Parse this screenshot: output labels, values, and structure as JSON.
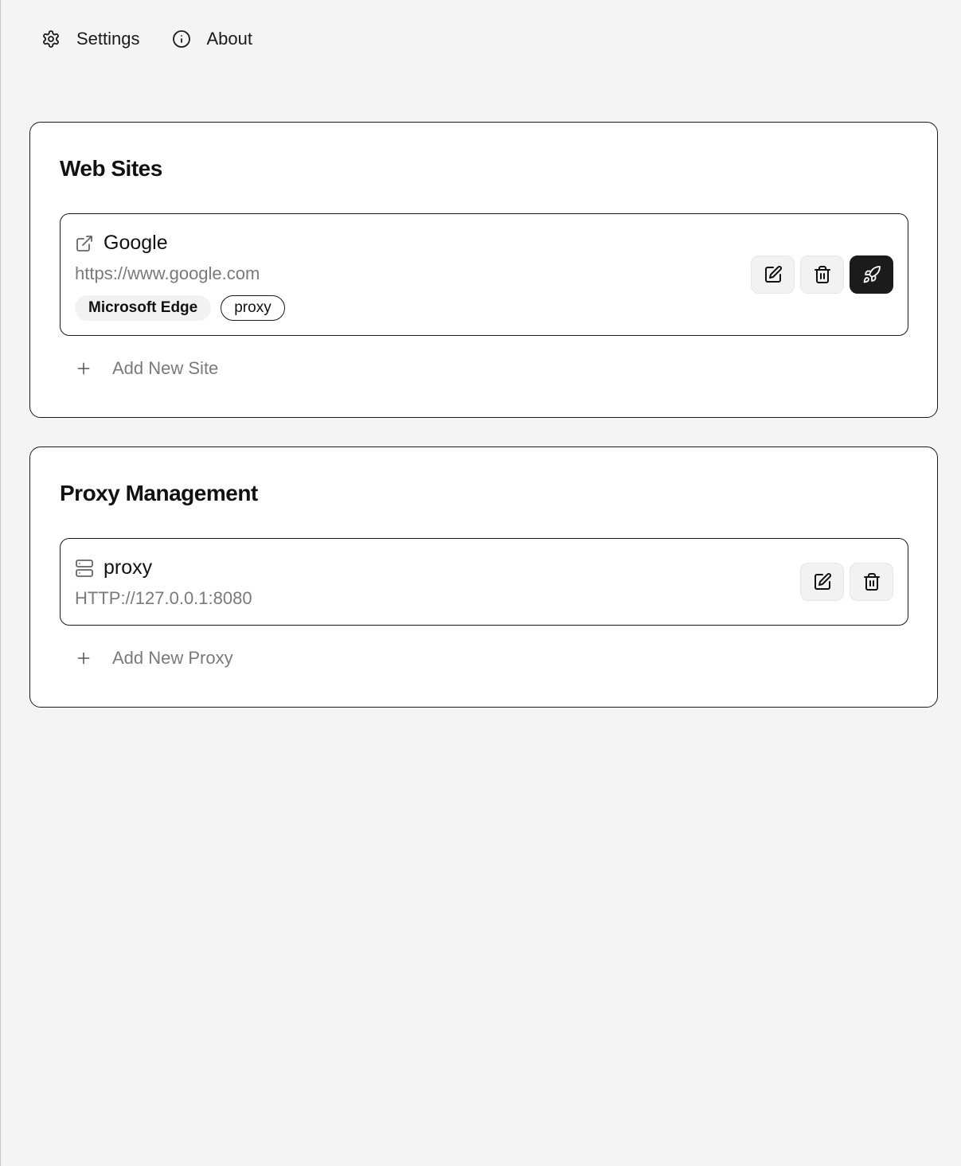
{
  "nav": {
    "settings_label": "Settings",
    "about_label": "About"
  },
  "websites": {
    "title": "Web Sites",
    "items": [
      {
        "name": "Google",
        "url": "https://www.google.com",
        "tags": [
          "Microsoft Edge",
          "proxy"
        ]
      }
    ],
    "add_label": "Add New Site"
  },
  "proxies": {
    "title": "Proxy Management",
    "items": [
      {
        "name": "proxy",
        "address": "HTTP://127.0.0.1:8080"
      }
    ],
    "add_label": "Add New Proxy"
  },
  "icons": {
    "settings": "gear-icon",
    "about": "info-icon",
    "site": "external-link-icon",
    "proxy": "server-icon",
    "edit": "edit-icon",
    "delete": "trash-icon",
    "launch": "rocket-icon",
    "add": "plus-icon"
  },
  "colors": {
    "background": "#f4f4f4",
    "card": "#ffffff",
    "border": "#1a1a1a",
    "muted_text": "#7a7a7a",
    "button_bg": "#f2f2f2",
    "primary_button": "#1b1b1b"
  }
}
